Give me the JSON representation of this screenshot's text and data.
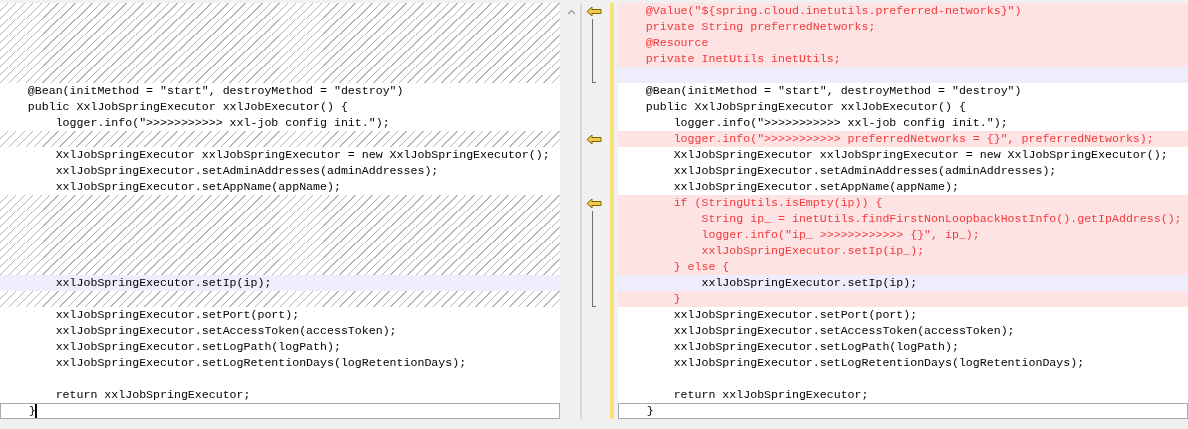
{
  "left": {
    "focused": true,
    "lines": [
      {
        "kind": "filler"
      },
      {
        "kind": "filler"
      },
      {
        "kind": "filler"
      },
      {
        "kind": "filler"
      },
      {
        "kind": "filler"
      },
      {
        "kind": "normal",
        "text": "    @Bean(initMethod = \"start\", destroyMethod = \"destroy\")"
      },
      {
        "kind": "normal",
        "text": "    public XxlJobSpringExecutor xxlJobExecutor() {"
      },
      {
        "kind": "normal",
        "text": "        logger.info(\">>>>>>>>>>> xxl-job config init.\");"
      },
      {
        "kind": "filler"
      },
      {
        "kind": "normal",
        "text": "        XxlJobSpringExecutor xxlJobSpringExecutor = new XxlJobSpringExecutor();"
      },
      {
        "kind": "normal",
        "text": "        xxlJobSpringExecutor.setAdminAddresses(adminAddresses);"
      },
      {
        "kind": "normal",
        "text": "        xxlJobSpringExecutor.setAppName(appName);"
      },
      {
        "kind": "filler"
      },
      {
        "kind": "filler"
      },
      {
        "kind": "filler"
      },
      {
        "kind": "filler"
      },
      {
        "kind": "filler"
      },
      {
        "kind": "changed",
        "text": "        xxlJobSpringExecutor.setIp(ip);"
      },
      {
        "kind": "filler"
      },
      {
        "kind": "normal",
        "text": "        xxlJobSpringExecutor.setPort(port);"
      },
      {
        "kind": "normal",
        "text": "        xxlJobSpringExecutor.setAccessToken(accessToken);"
      },
      {
        "kind": "normal",
        "text": "        xxlJobSpringExecutor.setLogPath(logPath);"
      },
      {
        "kind": "normal",
        "text": "        xxlJobSpringExecutor.setLogRetentionDays(logRetentionDays);"
      },
      {
        "kind": "normal"
      },
      {
        "kind": "normal",
        "text": "        return xxlJobSpringExecutor;"
      },
      {
        "kind": "normal",
        "text": "    }",
        "current": true
      }
    ]
  },
  "right": {
    "lines": [
      {
        "kind": "added",
        "text": "    @Value(\"${spring.cloud.inetutils.preferred-networks}\")"
      },
      {
        "kind": "added",
        "text": "    private String preferredNetworks;"
      },
      {
        "kind": "added",
        "text": "    @Resource"
      },
      {
        "kind": "added",
        "text": "    private InetUtils inetUtils;"
      },
      {
        "kind": "changed"
      },
      {
        "kind": "normal",
        "text": "    @Bean(initMethod = \"start\", destroyMethod = \"destroy\")"
      },
      {
        "kind": "normal",
        "text": "    public XxlJobSpringExecutor xxlJobExecutor() {"
      },
      {
        "kind": "normal",
        "text": "        logger.info(\">>>>>>>>>>> xxl-job config init.\");"
      },
      {
        "kind": "added",
        "text": "        logger.info(\">>>>>>>>>>> preferredNetworks = {}\", preferredNetworks);"
      },
      {
        "kind": "normal",
        "text": "        XxlJobSpringExecutor xxlJobSpringExecutor = new XxlJobSpringExecutor();"
      },
      {
        "kind": "normal",
        "text": "        xxlJobSpringExecutor.setAdminAddresses(adminAddresses);"
      },
      {
        "kind": "normal",
        "text": "        xxlJobSpringExecutor.setAppName(appName);"
      },
      {
        "kind": "added",
        "text": "        if (StringUtils.isEmpty(ip)) {"
      },
      {
        "kind": "added",
        "text": "            String ip_ = inetUtils.findFirstNonLoopbackHostInfo().getIpAddress();"
      },
      {
        "kind": "added",
        "text": "            logger.info(\"ip_ >>>>>>>>>>>> {}\", ip_);"
      },
      {
        "kind": "added",
        "text": "            xxlJobSpringExecutor.setIp(ip_);"
      },
      {
        "kind": "added",
        "text": "        } else {"
      },
      {
        "kind": "changed",
        "text": "            xxlJobSpringExecutor.setIp(ip);"
      },
      {
        "kind": "added",
        "text": "        }"
      },
      {
        "kind": "normal",
        "text": "        xxlJobSpringExecutor.setPort(port);"
      },
      {
        "kind": "normal",
        "text": "        xxlJobSpringExecutor.setAccessToken(accessToken);"
      },
      {
        "kind": "normal",
        "text": "        xxlJobSpringExecutor.setLogPath(logPath);"
      },
      {
        "kind": "normal",
        "text": "        xxlJobSpringExecutor.setLogRetentionDays(logRetentionDays);"
      },
      {
        "kind": "normal"
      },
      {
        "kind": "normal",
        "text": "        return xxlJobSpringExecutor;"
      },
      {
        "kind": "normal",
        "text": "    }",
        "current": true
      }
    ]
  }
}
